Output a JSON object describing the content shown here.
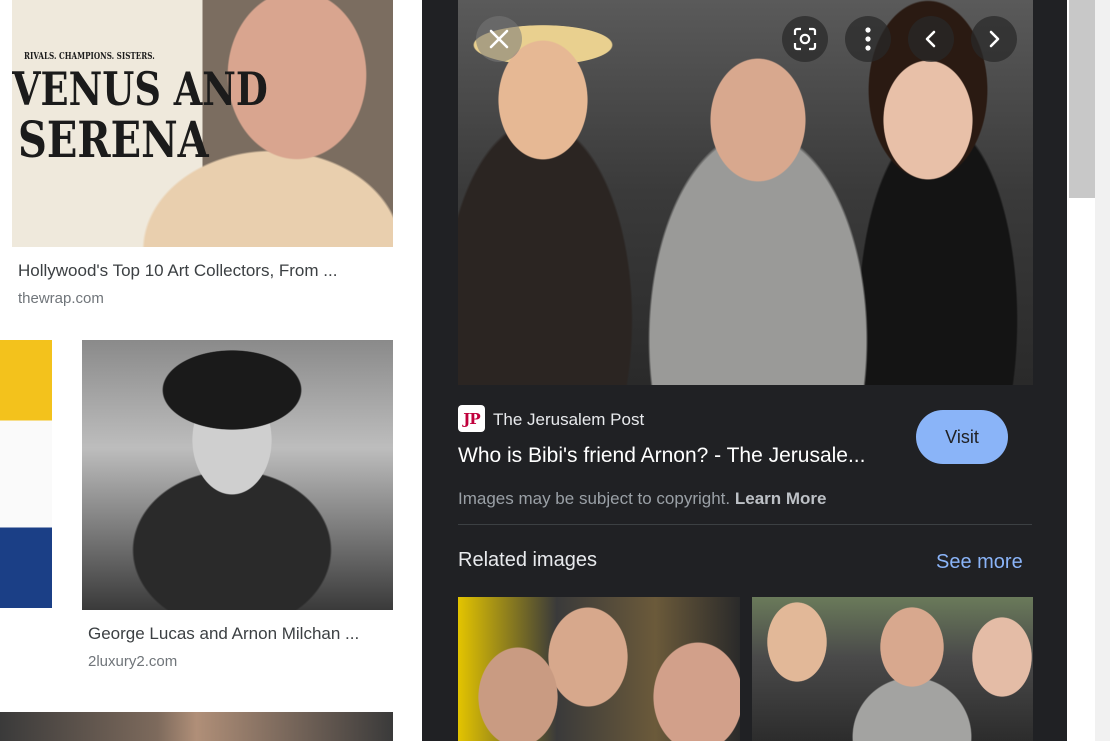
{
  "results": [
    {
      "caption": "Hollywood's Top 10 Art Collectors, From ...",
      "source": "thewrap.com",
      "poster_top": "RIVALS. CHAMPIONS. SISTERS.",
      "poster_title1": "VENUS AND",
      "poster_title2": "SERENA"
    },
    {
      "caption": "George Lucas and Arnon Milchan ...",
      "source": "2luxury2.com"
    }
  ],
  "viewer": {
    "source_logo": "JP",
    "source_name": "The Jerusalem Post",
    "title": "Who is Bibi's friend Arnon? - The Jerusale...",
    "visit_label": "Visit",
    "copyright_text": "Images may be subject to copyright.",
    "learn_more": "Learn More",
    "related_heading": "Related images",
    "see_more": "See more"
  },
  "colors": {
    "panel_bg": "#202124",
    "accent": "#8ab4f8"
  }
}
